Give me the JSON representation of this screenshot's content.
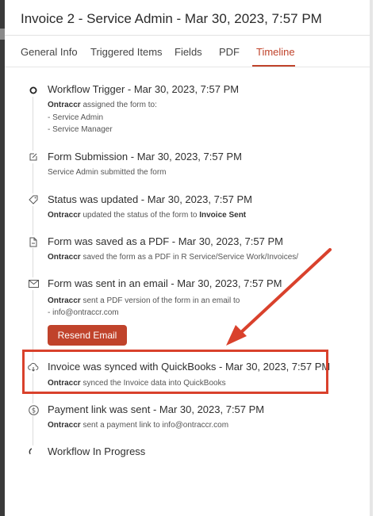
{
  "header": {
    "title": "Invoice 2 - Service Admin - Mar 30, 2023, 7:57 PM"
  },
  "tabs": [
    {
      "label": "General Info"
    },
    {
      "label": "Triggered Items"
    },
    {
      "label": "Fields"
    },
    {
      "label": "PDF"
    },
    {
      "label": "Timeline"
    }
  ],
  "active_tab": "Timeline",
  "events": [
    {
      "title": "Workflow Trigger - Mar 30, 2023, 7:57 PM",
      "actor": "Ontraccr",
      "text": " assigned the form to:",
      "lines": [
        "- Service Admin",
        "- Service Manager"
      ],
      "icon": "circle-icon"
    },
    {
      "title": "Form Submission - Mar 30, 2023, 7:57 PM",
      "text": "Service Admin submitted the form",
      "icon": "edit-icon"
    },
    {
      "title": "Status was updated - Mar 30, 2023, 7:57 PM",
      "actor": "Ontraccr",
      "text": " updated the status of the form to ",
      "strong": "Invoice Sent",
      "icon": "tag-icon"
    },
    {
      "title": "Form was saved as a PDF - Mar 30, 2023, 7:57 PM",
      "actor": "Ontraccr",
      "text": " saved the form as a PDF in R Service/Service Work/Invoices/",
      "icon": "pdf-file-icon"
    },
    {
      "title": "Form was sent in an email - Mar 30, 2023, 7:57 PM",
      "actor": "Ontraccr",
      "text": " sent a PDF version of the form in an email to",
      "lines": [
        "- info@ontraccr.com"
      ],
      "button": "Resend Email",
      "icon": "mail-icon"
    },
    {
      "title": "Invoice was synced with QuickBooks - Mar 30, 2023, 7:57 PM",
      "actor": "Ontraccr",
      "text": " synced the Invoice data into QuickBooks",
      "icon": "cloud-sync-icon"
    },
    {
      "title": "Payment link was sent - Mar 30, 2023, 7:57 PM",
      "actor": "Ontraccr",
      "text": " sent a payment link to info@ontraccr.com",
      "icon": "dollar-icon"
    },
    {
      "title": "Workflow In Progress",
      "icon": "loading-icon"
    }
  ],
  "colors": {
    "accent": "#c0432b",
    "annotation": "#d9412c"
  }
}
